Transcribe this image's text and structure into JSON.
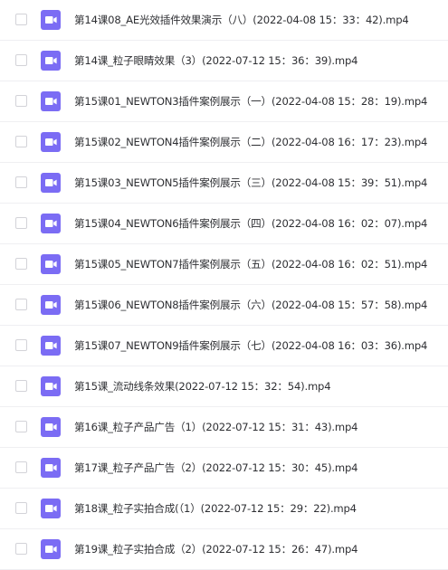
{
  "file_type_icon": "video-file-icon",
  "icon_color": "#7b6cf4",
  "files": [
    {
      "name": "第14课08_AE光效插件效果演示（八）(2022-04-08 15：33：42).mp4"
    },
    {
      "name": "第14课_粒子眼睛效果（3）(2022-07-12 15：36：39).mp4"
    },
    {
      "name": "第15课01_NEWTON3插件案例展示（一）(2022-04-08 15：28：19).mp4"
    },
    {
      "name": "第15课02_NEWTON4插件案例展示（二）(2022-04-08 16：17：23).mp4"
    },
    {
      "name": "第15课03_NEWTON5插件案例展示（三）(2022-04-08 15：39：51).mp4"
    },
    {
      "name": "第15课04_NEWTON6插件案例展示（四）(2022-04-08 16：02：07).mp4"
    },
    {
      "name": "第15课05_NEWTON7插件案例展示（五）(2022-04-08 16：02：51).mp4"
    },
    {
      "name": "第15课06_NEWTON8插件案例展示（六）(2022-04-08 15：57：58).mp4"
    },
    {
      "name": "第15课07_NEWTON9插件案例展示（七）(2022-04-08 16：03：36).mp4"
    },
    {
      "name": "第15课_流动线条效果(2022-07-12 15：32：54).mp4"
    },
    {
      "name": "第16课_粒子产品广告（1）(2022-07-12 15：31：43).mp4"
    },
    {
      "name": "第17课_粒子产品广告（2）(2022-07-12 15：30：45).mp4"
    },
    {
      "name": "第18课_粒子实拍合成(（1）(2022-07-12 15：29：22).mp4"
    },
    {
      "name": "第19课_粒子实拍合成（2）(2022-07-12 15：26：47).mp4"
    }
  ]
}
